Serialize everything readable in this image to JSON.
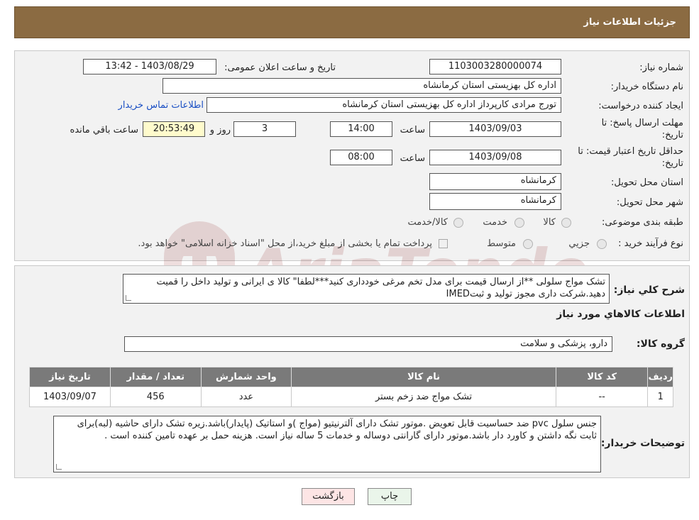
{
  "header": {
    "title": "جزئیات اطلاعات نیاز"
  },
  "watermark": {
    "text": "AriaTender.neT"
  },
  "form": {
    "need_number_label": "شماره نیاز:",
    "need_number": "1103003280000074",
    "announce_label": "تاریخ و ساعت اعلان عمومی:",
    "announce_value": "1403/08/29 - 13:42",
    "buyer_org_label": "نام دستگاه خریدار:",
    "buyer_org": "اداره کل بهزیستی استان کرمانشاه",
    "requester_label": "ایجاد کننده درخواست:",
    "requester": "تورج مرادی کارپرداز  اداره کل بهزیستی استان کرمانشاه",
    "contact_link": "اطلاعات تماس خریدار",
    "reply_deadline_label_1": "مهلت ارسال پاسخ: تا",
    "reply_deadline_label_2": "تاریخ:",
    "reply_date": "1403/09/03",
    "time_label": "ساعت",
    "reply_time": "14:00",
    "days_value": "3",
    "days_label": "روز و",
    "remaining_time": "20:53:49",
    "remaining_label": "ساعت باقي مانده",
    "validity_label_1": "حداقل تاریخ اعتبار قیمت: تا",
    "validity_label_2": "تاریخ:",
    "validity_date": "1403/09/08",
    "validity_time_label": "ساعت",
    "validity_time": "08:00",
    "province_label": "استان محل تحویل:",
    "province": "کرمانشاه",
    "city_label": "شهر محل تحویل:",
    "city": "کرمانشاه",
    "category_label": "طبقه بندی موضوعی:",
    "category_options": [
      "کالا",
      "خدمت",
      "کالا/خدمت"
    ],
    "purchase_type_label": "نوع فرآیند خرید :",
    "purchase_options": [
      "جزيي",
      "متوسط"
    ],
    "purchase_note": "پرداخت تمام یا بخشی از مبلغ خرید،از محل \"اسناد خزانه اسلامی\" خواهد بود."
  },
  "description": {
    "label": "شرح کلي نياز:",
    "text": "تشک مواج سلولی **از ارسال قیمت برای مدل تخم مرغی خودداری کنید***لطفا\" کالا ی ایرانی و تولید داخل را قمیت دهید.شرکت داری مجوز تولید و ثبتIMED"
  },
  "goods": {
    "section_title": "اطلاعات کالاهاي مورد نياز",
    "group_label": "گروه کالا:",
    "group_value": "دارو، پزشکی و سلامت",
    "columns": [
      "رديف",
      "کد کالا",
      "نام کالا",
      "واحد شمارش",
      "تعداد / مقدار",
      "تاريخ نياز"
    ],
    "rows": [
      {
        "row": "1",
        "code": "--",
        "name": "تشک مواج ضد زخم بستر",
        "unit": "عدد",
        "qty": "456",
        "date": "1403/09/07"
      }
    ]
  },
  "buyer_notes": {
    "label": "توضيحات خريدار:",
    "text": "جنس سلول pvc ضد حساسیت قابل تعویض .موتور تشک دارای آلترنیتیو (مواج )و استاتیک (پایدار)باشد.زیره تشک دارای حاشیه (لبه)برای ثابت نگه داشتن و کاورد دار باشد.موتور دارای گارانتی دوساله و خدمات 5 ساله نیاز است. هزینه حمل بر عهده تامین کننده است ."
  },
  "buttons": {
    "print": "چاپ",
    "back": "بازگشت"
  },
  "colors": {
    "header": "#8b6b42",
    "table_header": "#7a7a7a",
    "remaining_bg": "#fffbcc",
    "link": "#1a4fc4"
  }
}
